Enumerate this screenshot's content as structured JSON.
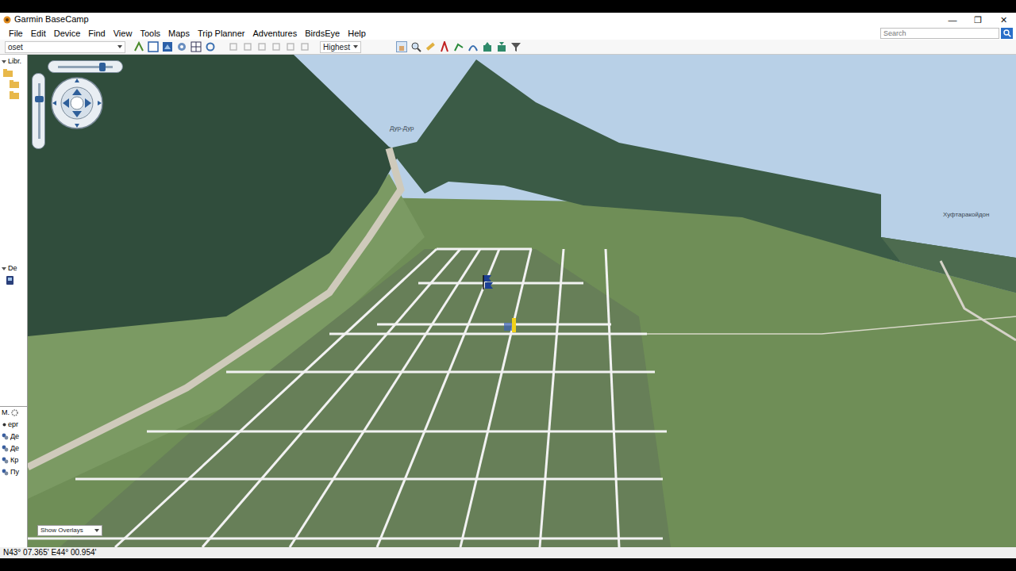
{
  "window": {
    "title": "Garmin BaseCamp",
    "controls": [
      "—",
      "❐",
      "✕"
    ]
  },
  "menu": [
    "File",
    "Edit",
    "Device",
    "Find",
    "View",
    "Tools",
    "Maps",
    "Trip Planner",
    "Adventures",
    "BirdsEye",
    "Help"
  ],
  "search": {
    "placeholder": "Search"
  },
  "toolbar": {
    "profile": "oset",
    "detail": "Highest"
  },
  "sidebar": {
    "library": "Libr.",
    "device": "De",
    "panel_title": "M.",
    "items": [
      "epr",
      "Де",
      "Де",
      "Кр",
      "Пу"
    ]
  },
  "map": {
    "zoom": {
      "level": 0.83
    },
    "tilt": {
      "level": 0.25
    },
    "labels": [
      "Дур-Дур",
      "Хуфтаракойдон"
    ],
    "waypoints": [
      {
        "color": "#1c3f94"
      },
      {
        "color": "#f2d21b"
      }
    ],
    "overlays": "Show Overlays"
  },
  "status_bar": "N43° 07.365' E44° 00.954'"
}
